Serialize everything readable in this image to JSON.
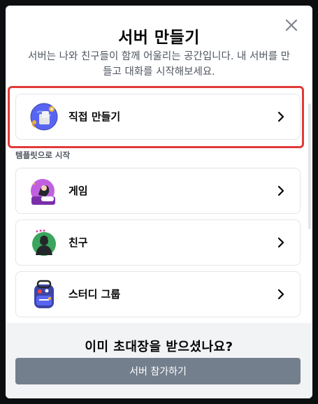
{
  "modal": {
    "title": "서버 만들기",
    "subtitle": "서버는 나와 친구들이 함께 어울리는 공간입니다. 내 서버를 만들고 대화를 시작해보세요.",
    "close_icon": "close-icon"
  },
  "create": {
    "label": "직접 만들기",
    "icon": "globe-icon"
  },
  "templates": {
    "section_label": "템플릿으로 시작",
    "items": [
      {
        "label": "게임",
        "icon": "game-character-icon"
      },
      {
        "label": "친구",
        "icon": "friend-character-icon"
      },
      {
        "label": "스터디 그룹",
        "icon": "backpack-icon"
      }
    ]
  },
  "footer": {
    "title": "이미 초대장을 받으셨나요?",
    "join_label": "서버 참가하기"
  },
  "colors": {
    "highlight": "#e13a3a",
    "join_button": "#747f8d",
    "footer_bg": "#f2f3f5"
  }
}
